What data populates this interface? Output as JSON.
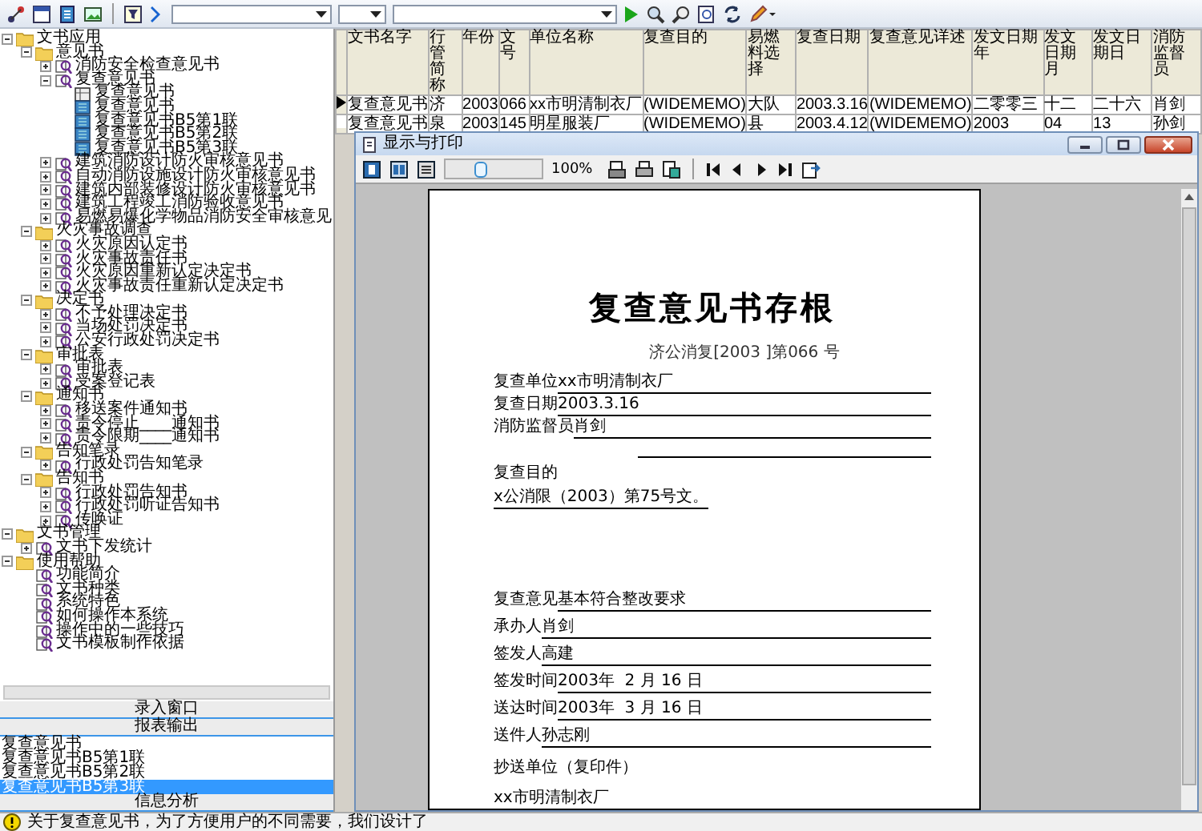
{
  "tree": [
    {
      "kind": "folder",
      "label": "文书应用",
      "expanded": true,
      "children": [
        {
          "kind": "folder",
          "label": "意见书",
          "expanded": true,
          "children": [
            {
              "kind": "doc",
              "label": "消防安全检查意见书",
              "expanded": false
            },
            {
              "kind": "doc",
              "label": "复查意见书",
              "expanded": true,
              "children": [
                {
                  "kind": "sheet",
                  "label": "复查意见书"
                },
                {
                  "kind": "page",
                  "label": "复查意见书"
                },
                {
                  "kind": "page",
                  "label": "复查意见书B5第1联"
                },
                {
                  "kind": "page",
                  "label": "复查意见书B5第2联"
                },
                {
                  "kind": "page",
                  "label": "复查意见书B5第3联"
                }
              ]
            },
            {
              "kind": "doc",
              "label": "建筑消防设计防火审核意见书",
              "expanded": false
            },
            {
              "kind": "doc",
              "label": "自动消防设施设计防火审核意见书",
              "expanded": false
            },
            {
              "kind": "doc",
              "label": "建筑内部装修设计防火审核意见书",
              "expanded": false
            },
            {
              "kind": "doc",
              "label": "建筑工程竣工消防验收意见书",
              "expanded": false
            },
            {
              "kind": "doc",
              "label": "易燃易爆化学物品消防安全审核意见",
              "expanded": false
            }
          ]
        },
        {
          "kind": "folder",
          "label": "火灾事故调查",
          "expanded": true,
          "children": [
            {
              "kind": "doc",
              "label": "火灾原因认定书",
              "expanded": false
            },
            {
              "kind": "doc",
              "label": "火灾事故责任书",
              "expanded": false
            },
            {
              "kind": "doc",
              "label": "火灾原因重新认定决定书",
              "expanded": false
            },
            {
              "kind": "doc",
              "label": "火灾事故责任重新认定决定书",
              "expanded": false
            }
          ]
        },
        {
          "kind": "folder",
          "label": "决定书",
          "expanded": true,
          "children": [
            {
              "kind": "doc",
              "label": "不予处理决定书",
              "expanded": false
            },
            {
              "kind": "doc",
              "label": "当场处罚决定书",
              "expanded": false
            },
            {
              "kind": "doc",
              "label": "公安行政处罚决定书",
              "expanded": false
            }
          ]
        },
        {
          "kind": "folder",
          "label": "审批表",
          "expanded": true,
          "children": [
            {
              "kind": "doc",
              "label": "审批表",
              "expanded": false
            },
            {
              "kind": "doc",
              "label": "受案登记表",
              "expanded": false
            }
          ]
        },
        {
          "kind": "folder",
          "label": "通知书",
          "expanded": true,
          "children": [
            {
              "kind": "doc",
              "label": "移送案件通知书",
              "expanded": false
            },
            {
              "kind": "doc",
              "label": "责令停止____通知书",
              "expanded": false
            },
            {
              "kind": "doc",
              "label": "责令限期____通知书",
              "expanded": false
            }
          ]
        },
        {
          "kind": "folder",
          "label": "告知笔录",
          "expanded": true,
          "children": [
            {
              "kind": "doc",
              "label": "行政处罚告知笔录",
              "expanded": false
            }
          ]
        },
        {
          "kind": "folder",
          "label": "告知书",
          "expanded": true,
          "children": [
            {
              "kind": "doc",
              "label": "行政处罚告知书",
              "expanded": false
            },
            {
              "kind": "doc",
              "label": "行政处罚听证告知书",
              "expanded": false
            },
            {
              "kind": "doc",
              "label": "传唤证",
              "expanded": false
            }
          ]
        }
      ]
    },
    {
      "kind": "folder",
      "label": "文书管理",
      "expanded": true,
      "children": [
        {
          "kind": "doc",
          "label": "文书下发统计",
          "expanded": false
        }
      ]
    },
    {
      "kind": "folder",
      "label": "使用帮助",
      "expanded": true,
      "children": [
        {
          "kind": "doc",
          "label": "功能简介"
        },
        {
          "kind": "doc",
          "label": "文书种类"
        },
        {
          "kind": "doc",
          "label": "系统特色"
        },
        {
          "kind": "doc",
          "label": "如何操作本系统"
        },
        {
          "kind": "doc",
          "label": "操作中的一些技巧"
        },
        {
          "kind": "doc",
          "label": "文书模板制作依据"
        }
      ]
    }
  ],
  "panel_sections": [
    "录入窗口",
    "报表输出"
  ],
  "report_list": [
    {
      "label": "复查意见书",
      "selected": false
    },
    {
      "label": "复查意见书B5第1联",
      "selected": false
    },
    {
      "label": "复查意见书B5第2联",
      "selected": false
    },
    {
      "label": "复查意见书B5第3联",
      "selected": true
    }
  ],
  "bottom_section": "信息分析",
  "status_bar": {
    "text": "关于复查意见书，为了方便用户的不同需要，我们设计了"
  },
  "table": {
    "columns": [
      "文书名字",
      "行管简称",
      "年份",
      "文号",
      "单位名称",
      "复查目的",
      "易燃料选择",
      "复查日期",
      "复查意见详述",
      "发文日期年",
      "发文日期月",
      "发文日期日",
      "消防监督员"
    ],
    "rows": [
      {
        "current": true,
        "cells": [
          "复查意见书",
          "济",
          "2003",
          "066",
          "xx市明清制衣厂",
          "(WIDEMEMO)",
          "大队",
          "2003.3.16",
          "(WIDEMEMO)",
          "二零零三",
          "十二",
          "二十六",
          "肖剑"
        ]
      },
      {
        "current": false,
        "cells": [
          "复查意见书",
          "泉",
          "2003",
          "145",
          "明星服装厂",
          "(WIDEMEMO)",
          "县",
          "2003.4.12",
          "(WIDEMEMO)",
          "2003",
          "04",
          "13",
          "孙剑"
        ]
      }
    ]
  },
  "dialog": {
    "title": "显示与打印",
    "zoom": {
      "level": 0.35,
      "reading": "100%"
    },
    "document": {
      "title": "复查意见书存根",
      "number": "济公消复[2003 ]第066 号",
      "upper": [
        {
          "kind": "field",
          "label": "复查单位",
          "value": "xx市明清制衣厂"
        },
        {
          "kind": "field",
          "label": "复查日期",
          "value": "2003.3.16"
        },
        {
          "kind": "field",
          "label": "消防监督员",
          "value": "肖剑"
        },
        {
          "kind": "blank"
        },
        {
          "kind": "text",
          "text": "复查目的"
        },
        {
          "kind": "underlined",
          "text": "x公消限（2003）第75号文。"
        }
      ],
      "lower": [
        {
          "kind": "field",
          "label": "复查意见",
          "value": "基本符合整改要求"
        },
        {
          "kind": "field",
          "label": "承办人",
          "value": "肖剑"
        },
        {
          "kind": "field",
          "label": "签发人",
          "value": "高建"
        },
        {
          "kind": "field",
          "label": "签发时间",
          "value": "2003年  2 月 16 日"
        },
        {
          "kind": "field",
          "label": "送达时间",
          "value": "2003年  3 月 16 日"
        },
        {
          "kind": "field",
          "label": "送件人",
          "value": "孙志刚"
        },
        {
          "kind": "text",
          "text": "抄送单位（复印件）"
        },
        {
          "kind": "text",
          "text": "xx市明清制衣厂"
        }
      ]
    }
  }
}
